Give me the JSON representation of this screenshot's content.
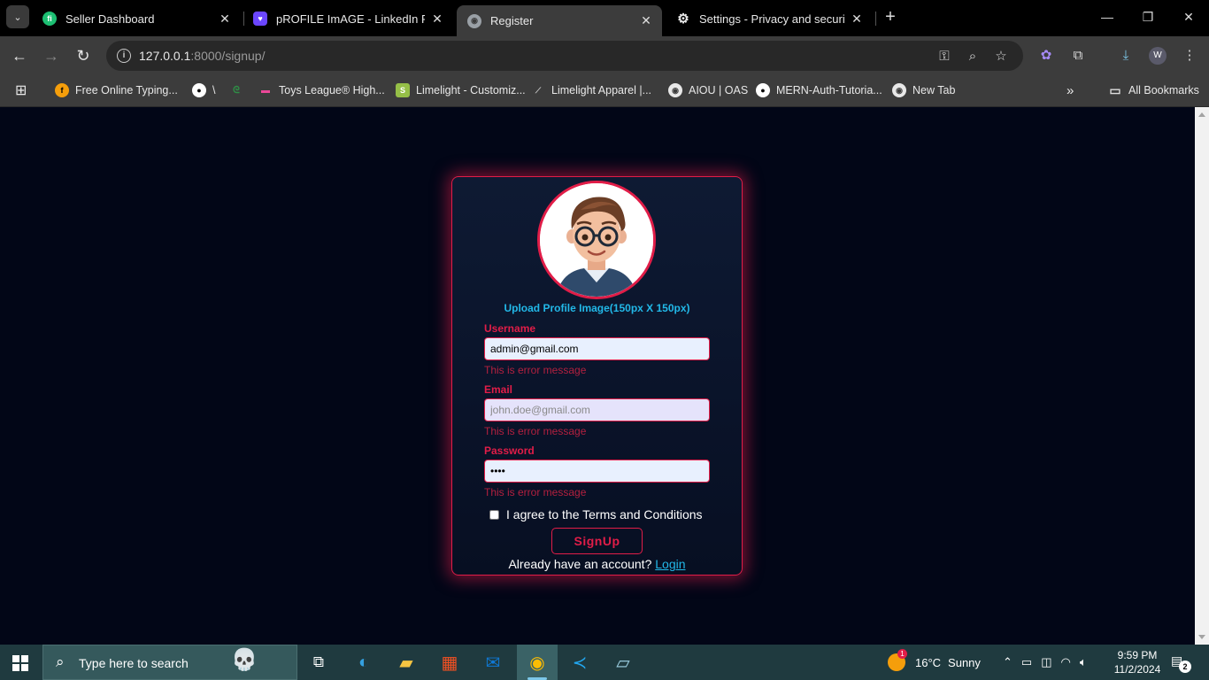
{
  "browser": {
    "tabs": [
      {
        "title": "Seller Dashboard",
        "favicon": "fiverr-icon",
        "color": "#1dbf73"
      },
      {
        "title": "pROFILE ImAGE - LinkedIn Post",
        "favicon": "heart-chat-icon",
        "color": "#6b46ff"
      },
      {
        "title": "Register",
        "favicon": "globe-icon",
        "color": "#9aa0a6"
      },
      {
        "title": "Settings - Privacy and security",
        "favicon": "gear-icon",
        "color": "#e8e8e8"
      }
    ],
    "close_glyph": "✕",
    "new_tab_glyph": "+",
    "url_host": "127.0.0.1",
    "url_path": ":8000/signup/",
    "profile_initial": "W",
    "bookmarks": [
      {
        "label": "Free Online Typing...",
        "favicon": "typing-icon",
        "color": "#f59e0b"
      },
      {
        "label": "\\",
        "favicon": "github-icon",
        "color": "#ffffff"
      },
      {
        "label": "",
        "favicon": "gfg-icon",
        "color": "#2f8d46"
      },
      {
        "label": "Toys League® High...",
        "favicon": "toys-icon",
        "color": "#ec4899"
      },
      {
        "label": "Limelight - Customiz...",
        "favicon": "shopify-icon",
        "color": "#95bf47"
      },
      {
        "label": "Limelight Apparel |...",
        "favicon": "limelight-icon",
        "color": "#cccccc"
      },
      {
        "label": "AIOU | OAS",
        "favicon": "globe-icon",
        "color": "#e8e8e8"
      },
      {
        "label": "MERN-Auth-Tutoria...",
        "favicon": "github-icon",
        "color": "#ffffff"
      },
      {
        "label": "New Tab",
        "favicon": "globe-icon",
        "color": "#e8e8e8"
      }
    ],
    "all_bookmarks_label": "All Bookmarks"
  },
  "form": {
    "upload_label": "Upload Profile Image(150px X 150px)",
    "username_label": "Username",
    "username_value": "admin@gmail.com",
    "email_label": "Email",
    "email_placeholder": "john.doe@gmail.com",
    "password_label": "Password",
    "password_value": "••••",
    "error_text": "This is error message",
    "terms_label": "I agree to the Terms and Conditions",
    "signup_label": "SignUp",
    "login_prompt": "Already have an account?",
    "login_link": "Login",
    "accent_color": "#e11d48",
    "link_color": "#22b8e8"
  },
  "taskbar": {
    "search_placeholder": "Type here to search",
    "weather_temp": "16°C",
    "weather_text": "Sunny",
    "time": "9:59 PM",
    "date": "11/2/2024",
    "notification_count": "2",
    "weather_badge": "1"
  }
}
